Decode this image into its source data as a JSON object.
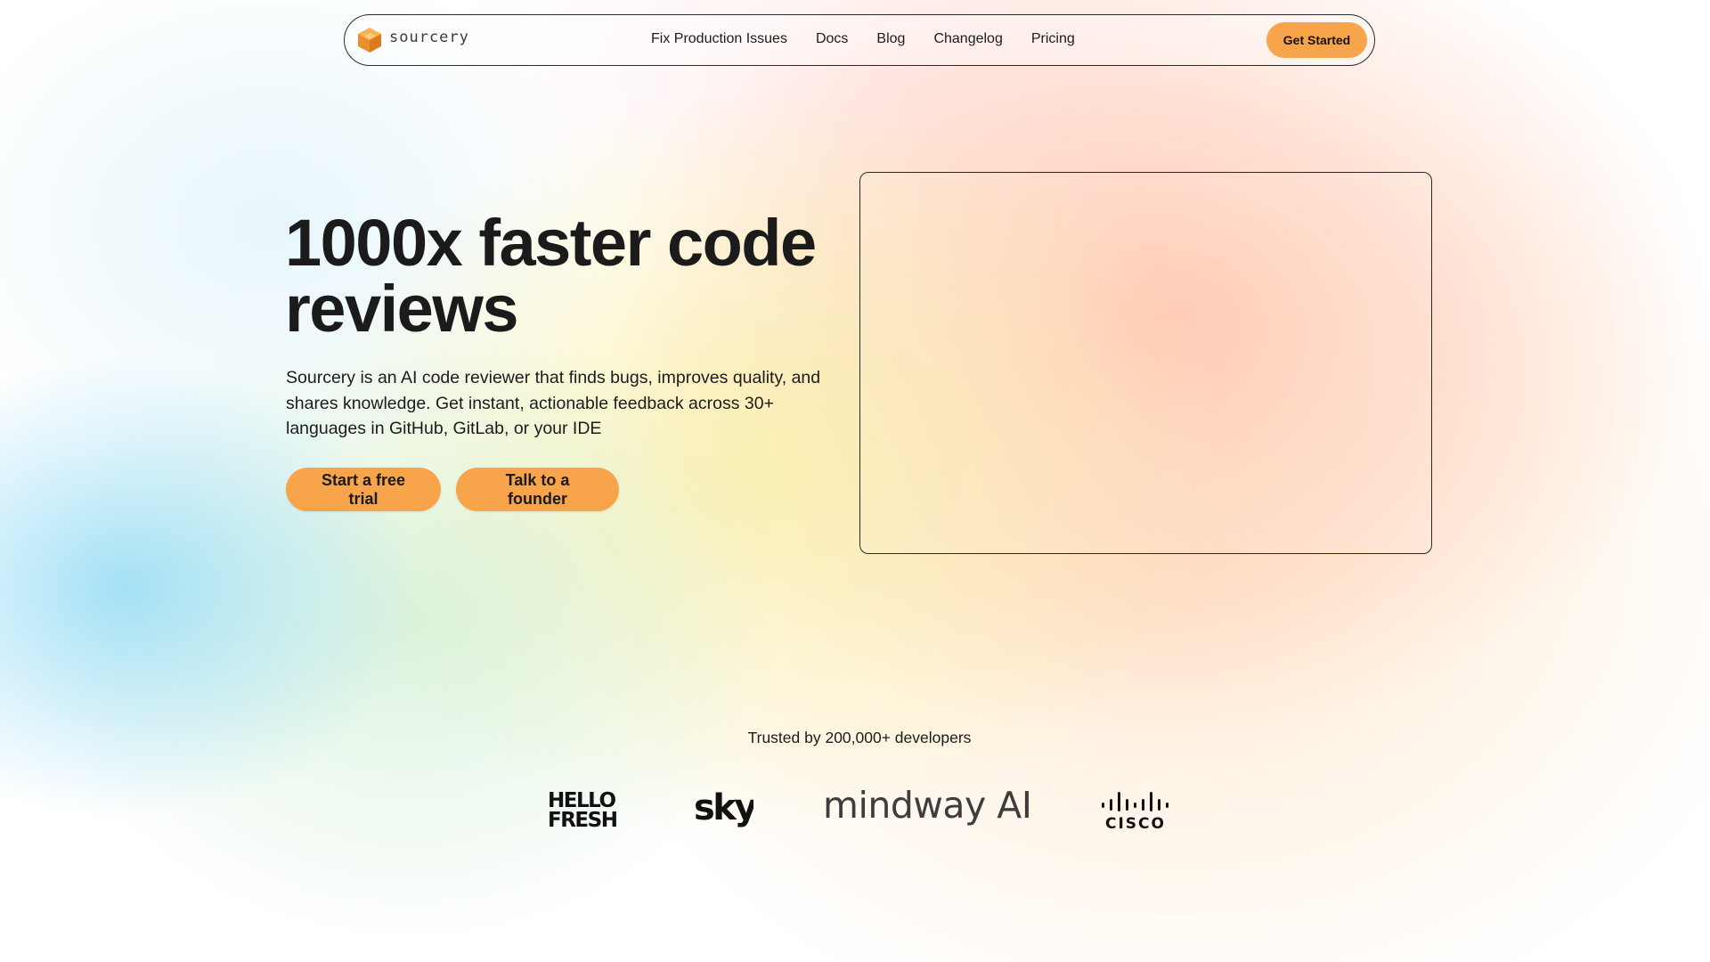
{
  "brand": {
    "name": "sourcery",
    "logo_icon": "sourcery-cube-icon",
    "logo_color": "#f2a13c"
  },
  "nav": {
    "links": [
      "Fix Production Issues",
      "Docs",
      "Blog",
      "Changelog",
      "Pricing"
    ],
    "cta_label": "Get Started"
  },
  "hero": {
    "title_line1": "1000x faster code",
    "title_line2": "reviews",
    "description": "Sourcery is an AI code reviewer that finds bugs, improves quality, and shares knowledge. Get instant, actionable feedback across 30+ languages in GitHub, GitLab, or your IDE",
    "primary_button": "Start a free trial",
    "secondary_button": "Talk to a founder"
  },
  "trust": {
    "text": "Trusted by 200,000+ developers",
    "logos": [
      {
        "name": "HelloFresh",
        "line1": "HELLO",
        "line2": "FRESH"
      },
      {
        "name": "Sky",
        "text": "sky"
      },
      {
        "name": "Mindway AI",
        "text": "mindway AI"
      },
      {
        "name": "Cisco",
        "text": "CISCO"
      }
    ]
  },
  "colors": {
    "accent": "#f7a44a",
    "text": "#1c1c1c",
    "border": "#2a2a2a"
  }
}
